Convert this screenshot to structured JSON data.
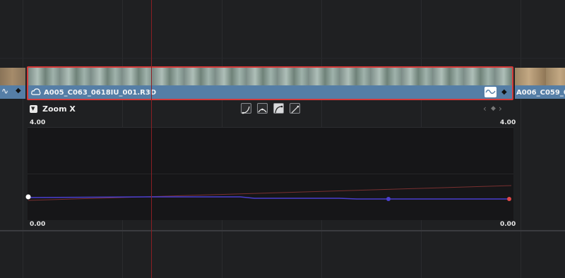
{
  "timeline": {
    "left_clip": {},
    "selected_clip": {
      "name": "A005_C063_0618IU_001.R3D"
    },
    "right_clip": {
      "name": "A006_C059_062"
    }
  },
  "keyframe_editor": {
    "parameter_label": "Zoom X",
    "y_max_left": "4.00",
    "y_max_right": "4.00",
    "y_min_left": "0.00",
    "y_min_right": "0.00",
    "curve_buttons": [
      {
        "icon": "curve-ease-in-icon",
        "active": false
      },
      {
        "icon": "curve-ease-in-out-icon",
        "active": false
      },
      {
        "icon": "curve-ease-out-icon",
        "active": true
      },
      {
        "icon": "curve-linear-icon",
        "active": false
      }
    ],
    "nav": {
      "prev": "‹",
      "key": "◆",
      "next": "›"
    }
  },
  "colors": {
    "playhead": "#8b1f24",
    "selected_outline": "#d43a3a",
    "curve_blue": "#4a3fd0",
    "curve_red": "#7a3030",
    "clip_bar": "#557ea6"
  }
}
